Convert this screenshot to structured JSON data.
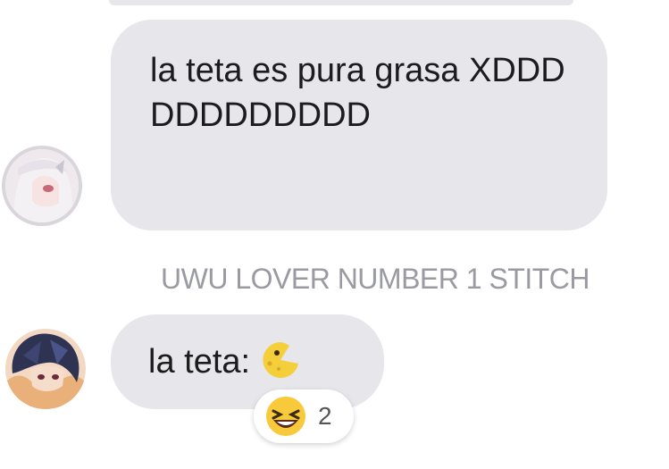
{
  "messages": [
    {
      "text": "la teta es pura grasa XDDDDDDDDDDDD",
      "avatar_icon": "anime-girl-avatar-icon"
    },
    {
      "sender_name": "UWU LOVER NUMBER 1 STITCH",
      "text": "la teta:",
      "inline_emoji": "pacman-moon-emoji-icon",
      "avatar_icon": "anime-boy-avatar-icon",
      "reaction": {
        "emoji": "laughing-face-icon",
        "count": "2"
      }
    }
  ],
  "colors": {
    "bubble": "#e6e6eb",
    "sender_name": "#9a9aa2",
    "text": "#1c1c1e"
  }
}
